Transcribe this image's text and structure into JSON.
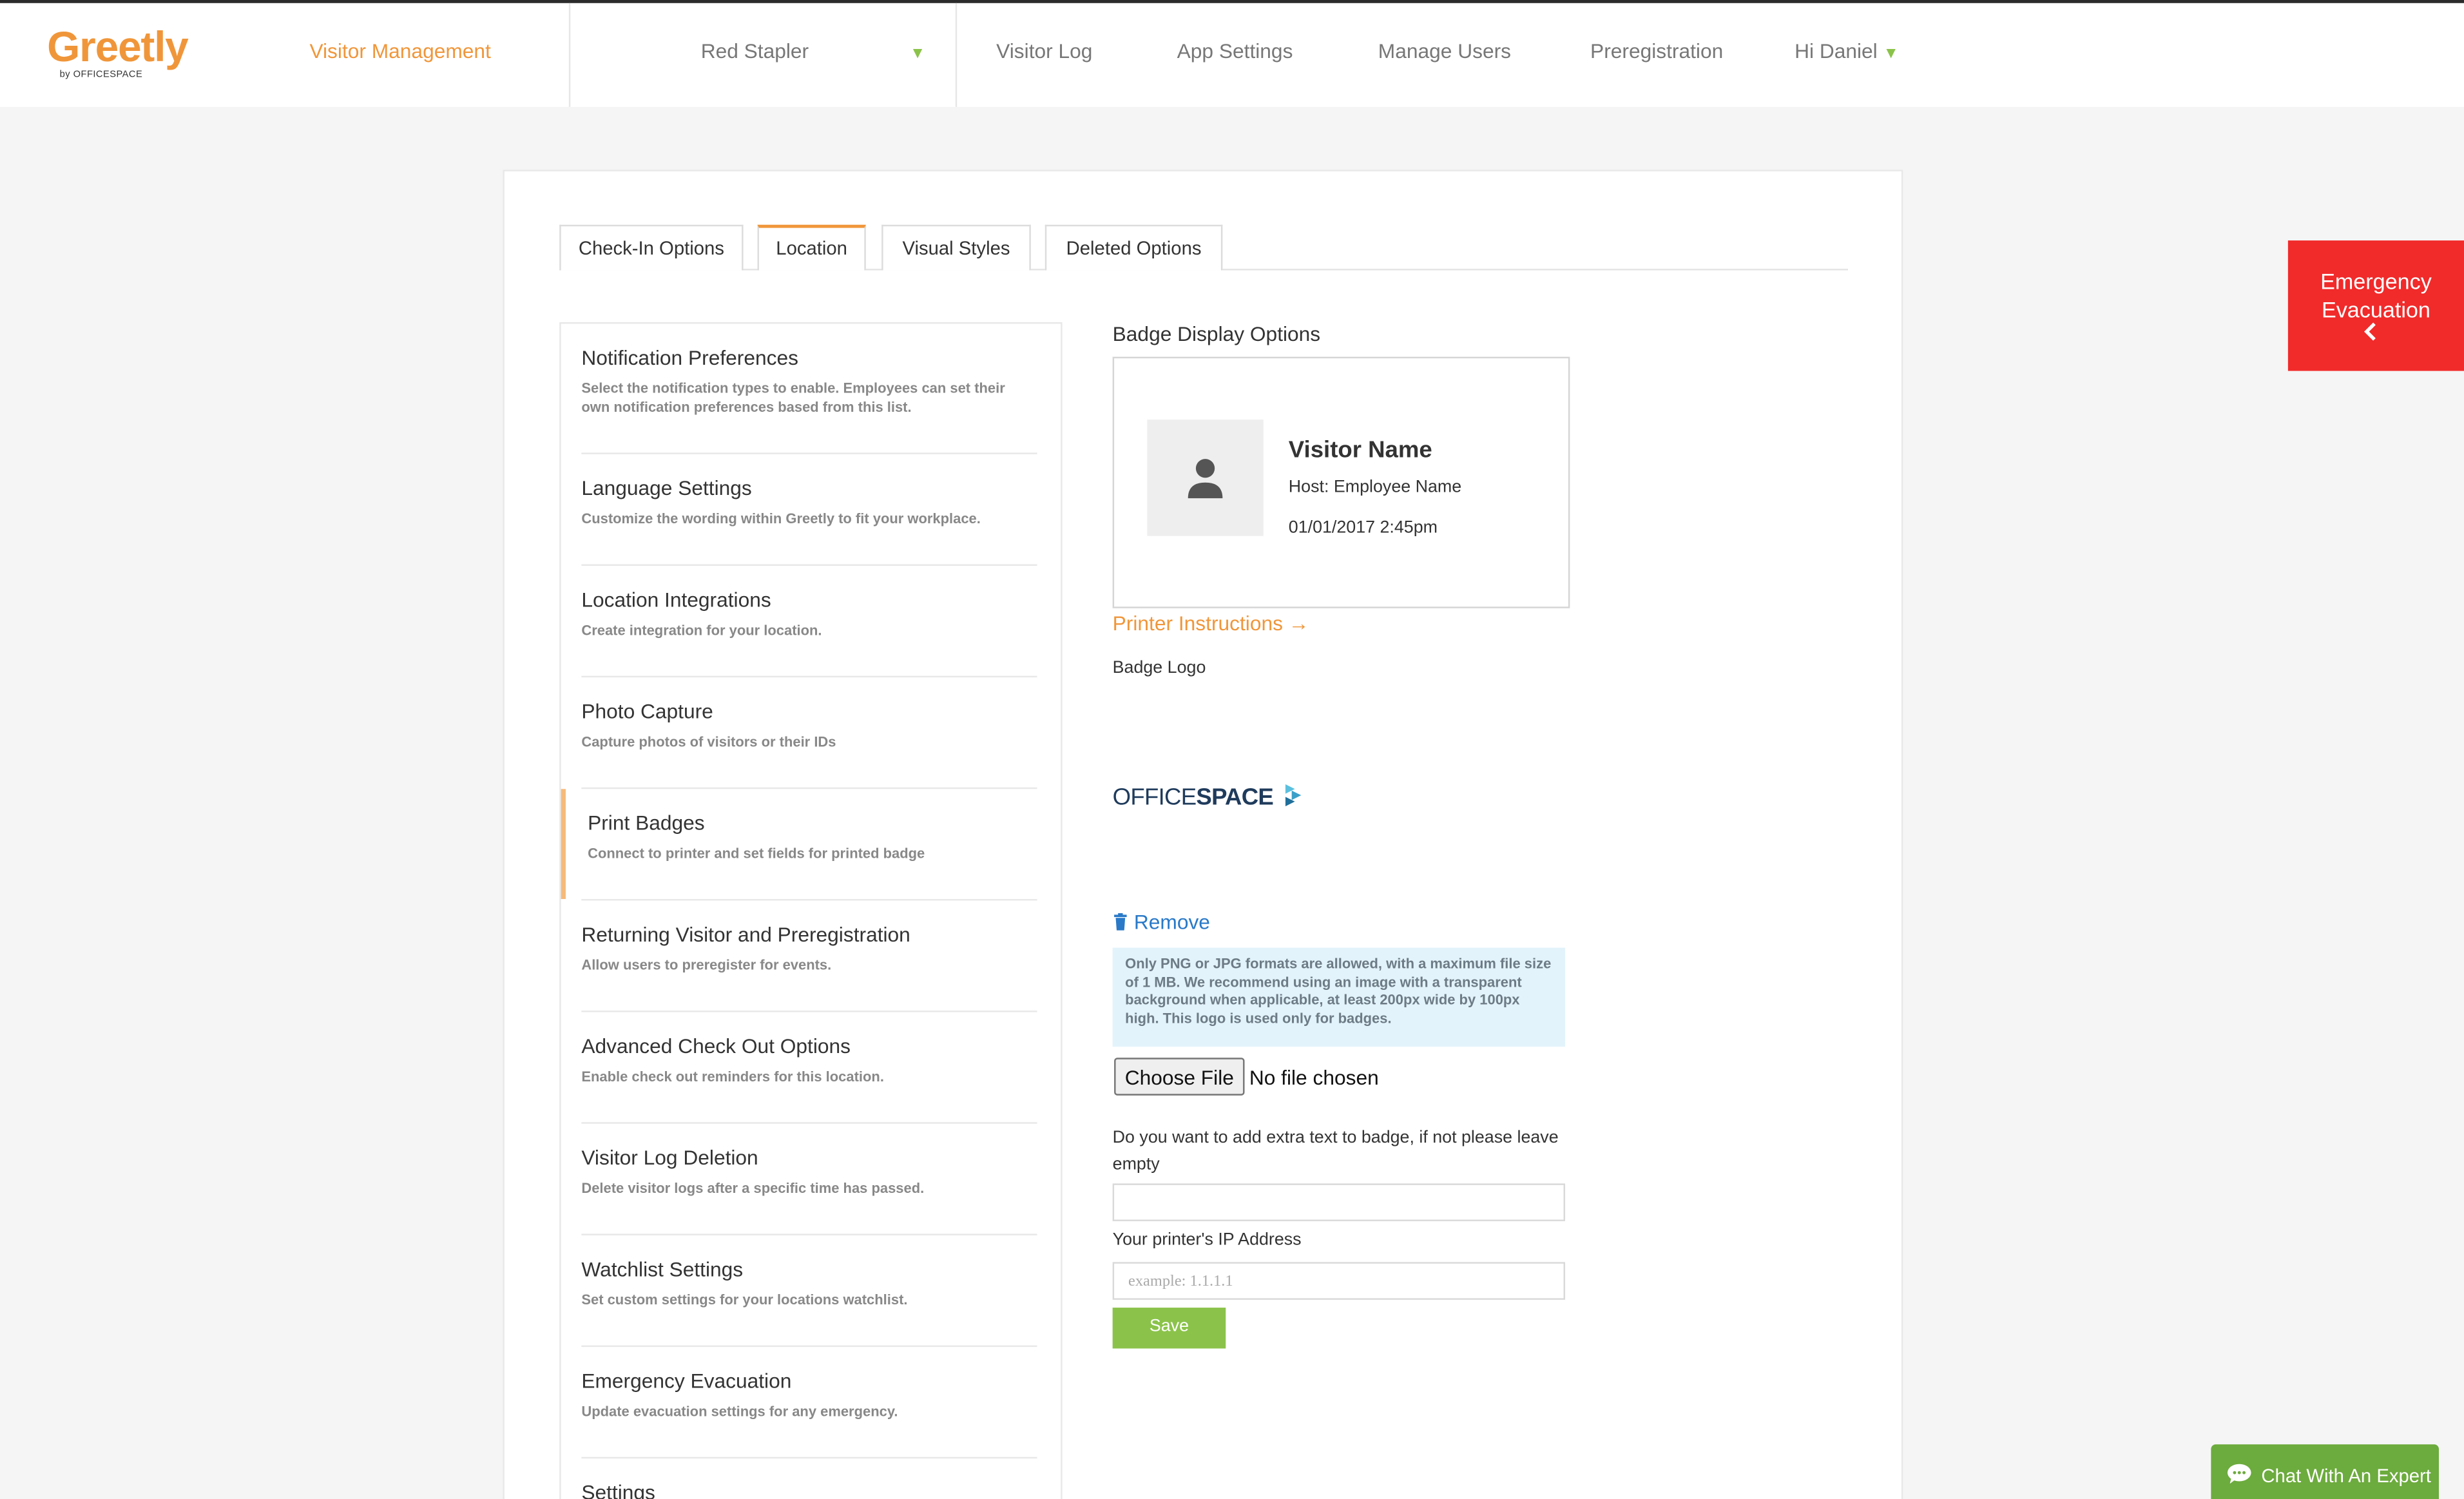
{
  "header": {
    "logo_main": "Greetly",
    "logo_sub": "by OFFICESPACE",
    "visitor_management": "Visitor Management",
    "location_select": "Red Stapler",
    "nav": [
      "Visitor Log",
      "App Settings",
      "Manage Users",
      "Preregistration"
    ],
    "user_greeting": "Hi Daniel"
  },
  "tabs": [
    {
      "label": "Check-In Options",
      "active": false
    },
    {
      "label": "Location",
      "active": true
    },
    {
      "label": "Visual Styles",
      "active": false
    },
    {
      "label": "Deleted Options",
      "active": false
    }
  ],
  "settings": [
    {
      "title": "Notification Preferences",
      "desc": "Select the notification types to enable. Employees can set their own notification preferences based from this list."
    },
    {
      "title": "Language Settings",
      "desc": "Customize the wording within Greetly to fit your workplace."
    },
    {
      "title": "Location Integrations",
      "desc": "Create integration for your location."
    },
    {
      "title": "Photo Capture",
      "desc": "Capture photos of visitors or their IDs"
    },
    {
      "title": "Print Badges",
      "desc": "Connect to printer and set fields for printed badge"
    },
    {
      "title": "Returning Visitor and Preregistration",
      "desc": "Allow users to preregister for events."
    },
    {
      "title": "Advanced Check Out Options",
      "desc": "Enable check out reminders for this location."
    },
    {
      "title": "Visitor Log Deletion",
      "desc": "Delete visitor logs after a specific time has passed."
    },
    {
      "title": "Watchlist Settings",
      "desc": "Set custom settings for your locations watchlist."
    },
    {
      "title": "Emergency Evacuation",
      "desc": "Update evacuation settings for any emergency."
    },
    {
      "title": "Settings",
      "desc": ""
    }
  ],
  "badge": {
    "section_title": "Badge Display Options",
    "visitor_name": "Visitor Name",
    "host": "Host: Employee Name",
    "date": "01/01/2017 2:45pm",
    "printer_instructions": "Printer Instructions →",
    "logo_label": "Badge Logo",
    "logo_text_light": "OFFICE",
    "logo_text_bold": "SPACE",
    "remove": "Remove",
    "info": "Only PNG or JPG formats are allowed, with a maximum file size of 1 MB. We recommend using an image with a transparent background when applicable, at least 200px wide by 100px high. This logo is used only for badges.",
    "choose_file": "Choose File",
    "file_status": "No file chosen",
    "extra_text_label": "Do you want to add extra text to badge, if not please leave empty",
    "extra_text_value": "",
    "ip_label": "Your printer's IP Address",
    "ip_placeholder": "example: 1.1.1.1",
    "save": "Save"
  },
  "emergency": {
    "line1": "Emergency",
    "line2": "Evacuation"
  },
  "chat": {
    "label": "Chat With An Expert"
  },
  "colors": {
    "brand_orange": "#f0963a",
    "green": "#8bc34a",
    "emergency_red": "#f12a2a",
    "link_blue": "#2979c8",
    "info_bg": "#e3f3fb"
  }
}
